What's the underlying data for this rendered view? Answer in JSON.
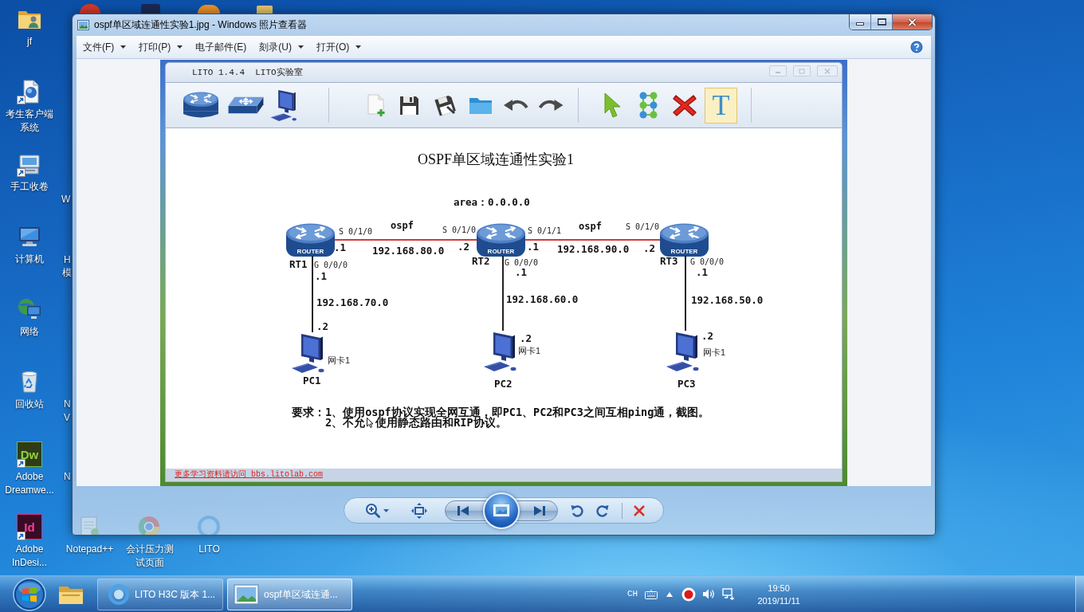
{
  "desktop": {
    "icons": [
      {
        "label": "jf",
        "kind": "user-folder",
        "shortcut": false
      },
      {
        "label": "考生客户端系统",
        "kind": "client",
        "shortcut": true
      },
      {
        "label": "手工收卷",
        "kind": "scanner",
        "shortcut": true
      },
      {
        "label": "计算机",
        "kind": "computer",
        "shortcut": false
      },
      {
        "label": "网络",
        "kind": "network",
        "shortcut": false
      },
      {
        "label": "回收站",
        "kind": "recycle-bin",
        "shortcut": false
      },
      {
        "label": "Adobe Dreamwe...",
        "kind": "dreamweaver",
        "logo": "Dw",
        "shortcut": true
      },
      {
        "label": "Adobe InDesi...",
        "kind": "indesign",
        "logo": "Id",
        "shortcut": true
      }
    ],
    "partly_hidden_labels": [
      "W",
      "H",
      "模",
      "N",
      "V",
      "N"
    ],
    "lower_icons": [
      {
        "label": "Notepad++",
        "kind": "notepad"
      },
      {
        "label": "会计压力测试页面",
        "kind": "browser"
      },
      {
        "label": "LITO",
        "kind": "lito"
      }
    ]
  },
  "window": {
    "title": "ospf单区域连通性实验1.jpg - Windows 照片查看器",
    "menu": [
      {
        "label": "文件(F)",
        "dropdown": true
      },
      {
        "label": "打印(P)",
        "dropdown": true
      },
      {
        "label": "电子邮件(E)",
        "dropdown": false
      },
      {
        "label": "刻录(U)",
        "dropdown": true
      },
      {
        "label": "打开(O)",
        "dropdown": true
      }
    ],
    "image": {
      "app_title": "LITO 1.4.4  LITO实验室",
      "tool_groups": [
        [
          {
            "kind": "router"
          },
          {
            "kind": "switch"
          },
          {
            "kind": "pc"
          }
        ],
        [
          {
            "kind": "new"
          },
          {
            "kind": "save"
          },
          {
            "kind": "save-as"
          },
          {
            "kind": "open"
          },
          {
            "kind": "undo"
          },
          {
            "kind": "redo"
          }
        ],
        [
          {
            "kind": "select",
            "selected": false
          },
          {
            "kind": "connect",
            "selected": false
          },
          {
            "kind": "delete",
            "selected": false
          },
          {
            "kind": "text",
            "glyph": "T",
            "selected": true
          }
        ]
      ],
      "diagram": {
        "title": "OSPF单区域连通性实验1",
        "area": "area：0.0.0.0",
        "routers": [
          {
            "name": "RT1",
            "badge": "ROUTER"
          },
          {
            "name": "RT2",
            "badge": "ROUTER"
          },
          {
            "name": "RT3",
            "badge": "ROUTER"
          }
        ],
        "serial_links": [
          {
            "protocol": "ospf",
            "network": "192.168.80.0",
            "left_port": "S 0/1/0",
            "left_host": ".1",
            "right_port": "S 0/1/0",
            "right_host": ".2"
          },
          {
            "protocol": "ospf",
            "network": "192.168.90.0",
            "left_port": "S 0/1/1",
            "left_host": ".1",
            "right_port": "S 0/1/0",
            "right_host": ".2"
          }
        ],
        "lans": [
          {
            "router_port": "G 0/0/0",
            "router_host": ".1",
            "network": "192.168.70.0",
            "pc_host": ".2",
            "nic": "网卡1",
            "pc": "PC1"
          },
          {
            "router_port": "G 0/0/0",
            "router_host": ".1",
            "network": "192.168.60.0",
            "pc_host": ".2",
            "nic": "网卡1",
            "pc": "PC2"
          },
          {
            "router_port": "G 0/0/0",
            "router_host": ".1",
            "network": "192.168.50.0",
            "pc_host": ".2",
            "nic": "网卡1",
            "pc": "PC3"
          }
        ],
        "requirements": {
          "label": "要求：",
          "items": [
            {
              "parts": [
                "1、使用ospf协议实现全网互通，即PC1、PC2和PC3之间互相ping通，截图。"
              ]
            },
            {
              "parts": [
                "2、不允",
                "使用静态路由和RIP协议。"
              ]
            }
          ]
        }
      },
      "footer_link": "更多学习资料请访问 bbs.litolab.com"
    }
  },
  "taskbar": {
    "buttons": [
      {
        "label": "LITO H3C 版本 1...",
        "kind": "lito",
        "selected": false
      },
      {
        "label": "ospf单区域连通...",
        "kind": "photo",
        "selected": true
      }
    ],
    "input_language": "CH",
    "time": "19:50",
    "date": "2019/11/11"
  }
}
